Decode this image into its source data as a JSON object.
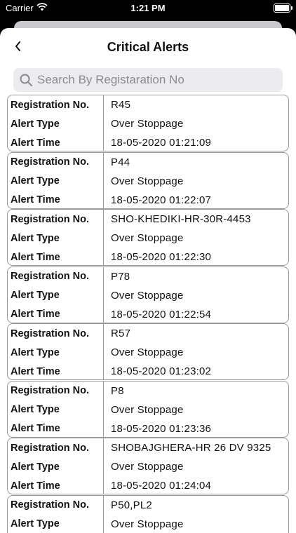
{
  "status": {
    "carrier": "Carrier",
    "time": "1:21 PM"
  },
  "header": {
    "title": "Critical Alerts"
  },
  "search": {
    "placeholder": "Search By Registaration No"
  },
  "labels": {
    "registration": "Registration No.",
    "alert_type": "Alert Type",
    "alert_time": "Alert Time"
  },
  "alerts": [
    {
      "registration": "R45",
      "type": "Over Stoppage",
      "time": "18-05-2020 01:21:09"
    },
    {
      "registration": "P44",
      "type": "Over Stoppage",
      "time": "18-05-2020 01:22:07"
    },
    {
      "registration": "SHO-KHEDIKI-HR-30R-4453",
      "type": "Over Stoppage",
      "time": "18-05-2020 01:22:30"
    },
    {
      "registration": "P78",
      "type": "Over Stoppage",
      "time": "18-05-2020 01:22:54"
    },
    {
      "registration": "R57",
      "type": "Over Stoppage",
      "time": "18-05-2020 01:23:02"
    },
    {
      "registration": "P8",
      "type": "Over Stoppage",
      "time": "18-05-2020 01:23:36"
    },
    {
      "registration": "SHOBAJGHERA-HR 26 DV 9325",
      "type": "Over Stoppage",
      "time": "18-05-2020 01:24:04"
    },
    {
      "registration": "P50,PL2",
      "type": "Over Stoppage",
      "time": ""
    }
  ],
  "icons": {
    "back": "chevron-left-icon",
    "search": "search-icon",
    "wifi": "wifi-icon",
    "battery": "battery-icon"
  }
}
